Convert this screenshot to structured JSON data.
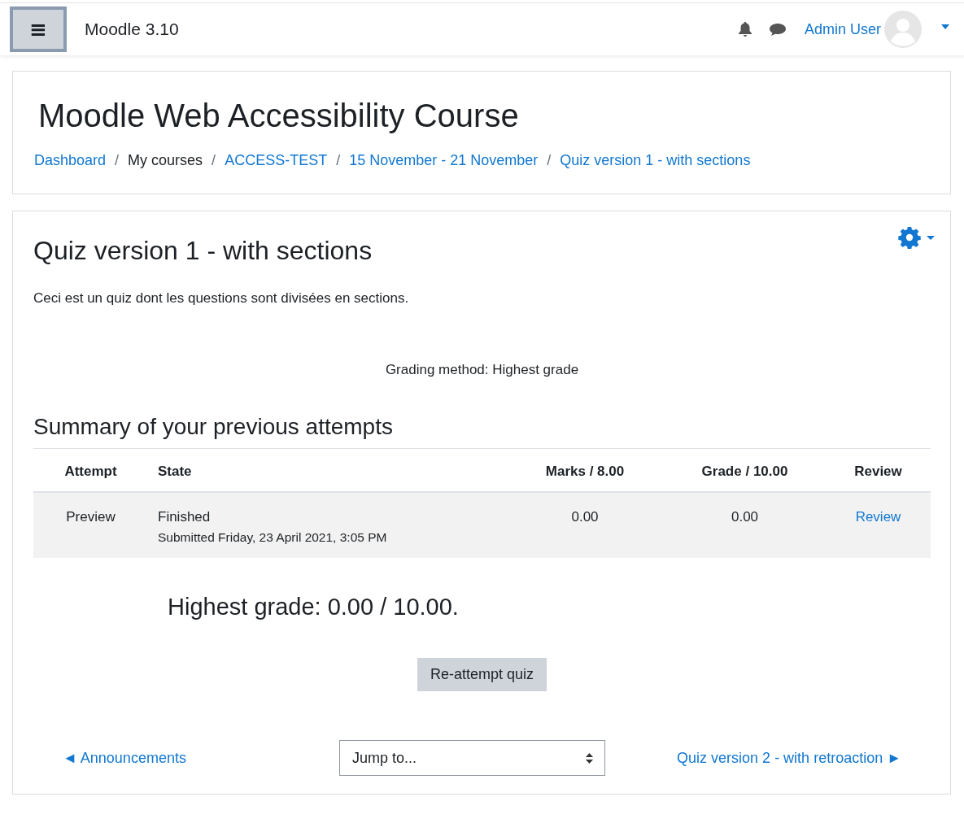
{
  "navbar": {
    "menu_icon": "≡",
    "site_name": "Moodle 3.10",
    "user_name": "Admin User",
    "menu_button": {
      "focused": true
    }
  },
  "header": {
    "title": "Moodle Web Accessibility Course",
    "breadcrumb": [
      {
        "label": "Dashboard",
        "link": true
      },
      {
        "separator": "/",
        "label": "My courses",
        "link": false
      },
      {
        "separator": "/",
        "label": "ACCESS-TEST",
        "link": true
      },
      {
        "separator": "/",
        "label": "15 November - 21 November",
        "link": true
      },
      {
        "separator": "/",
        "label": "Quiz version 1 - with sections",
        "link": true
      }
    ]
  },
  "quiz": {
    "title": "Quiz version 1 - with sections",
    "intro": "Ceci est un quiz dont les questions sont divisées en sections.",
    "grading_method": "Grading method: Highest grade",
    "summary_title": "Summary of your previous attempts",
    "table": {
      "columns": [
        "Attempt",
        "State",
        "Marks / 8.00",
        "Grade / 10.00",
        "Review"
      ],
      "rows": [
        {
          "attempt": "Preview",
          "state": "Finished",
          "submitted": "Submitted Friday, 23 April 2021, 3:05 PM",
          "marks": "0.00",
          "grade": "0.00",
          "review": "Review"
        }
      ]
    },
    "highest_grade": "Highest grade: 0.00 / 10.00.",
    "reattempt_button": "Re-attempt quiz"
  },
  "footer_nav": {
    "previous": "◄ Announcements",
    "jump_placeholder": "Jump to...",
    "next": "Quiz version 2 - with retroaction ►"
  }
}
